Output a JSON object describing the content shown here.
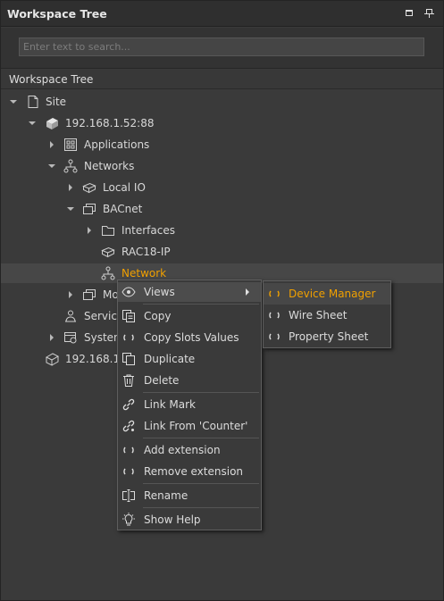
{
  "panel": {
    "title": "Workspace Tree",
    "search_placeholder": "Enter text to search...",
    "tree_header": "Workspace Tree"
  },
  "tree": [
    {
      "label": "Site",
      "icon": "file-icon",
      "arrow": "down"
    },
    {
      "label": "192.168.1.52:88",
      "icon": "station-icon",
      "arrow": "down"
    },
    {
      "label": "Applications",
      "icon": "applications-icon",
      "arrow": "right"
    },
    {
      "label": "Networks",
      "icon": "networks-icon",
      "arrow": "down"
    },
    {
      "label": "Local IO",
      "icon": "device-icon",
      "arrow": "right"
    },
    {
      "label": "BACnet",
      "icon": "network-folder-icon",
      "arrow": "down"
    },
    {
      "label": "Interfaces",
      "icon": "folder-icon",
      "arrow": "right"
    },
    {
      "label": "RAC18-IP",
      "icon": "device-icon",
      "arrow": "none"
    },
    {
      "label": "Network",
      "icon": "network-icon",
      "arrow": "none"
    },
    {
      "label": "Mo",
      "icon": "network-folder-icon",
      "arrow": "right"
    },
    {
      "label": "Service",
      "icon": "services-icon",
      "arrow": "none"
    },
    {
      "label": "System",
      "icon": "system-icon",
      "arrow": "right"
    },
    {
      "label": "192.168.1.",
      "icon": "station-icon",
      "arrow": "none"
    }
  ],
  "context_menu": [
    {
      "label": "Views",
      "icon": "eye-icon",
      "submenu": true
    },
    {
      "label": "Copy",
      "icon": "copy-icon"
    },
    {
      "label": "Copy Slots Values",
      "icon": "action-icon"
    },
    {
      "label": "Duplicate",
      "icon": "duplicate-icon"
    },
    {
      "label": "Delete",
      "icon": "trash-icon"
    },
    {
      "label": "Link Mark",
      "icon": "link-icon"
    },
    {
      "label": "Link From 'Counter'",
      "icon": "link-from-icon"
    },
    {
      "label": "Add extension",
      "icon": "action-icon"
    },
    {
      "label": "Remove extension",
      "icon": "action-icon"
    },
    {
      "label": "Rename",
      "icon": "rename-icon"
    },
    {
      "label": "Show Help",
      "icon": "help-bulb-icon"
    }
  ],
  "views_submenu": [
    {
      "label": "Device Manager",
      "icon": "action-icon",
      "highlighted": true
    },
    {
      "label": "Wire Sheet",
      "icon": "action-icon"
    },
    {
      "label": "Property Sheet",
      "icon": "action-icon"
    }
  ],
  "colors": {
    "background": "#3a3a3a",
    "accent": "#f0a000",
    "text": "#d8d8d8"
  }
}
